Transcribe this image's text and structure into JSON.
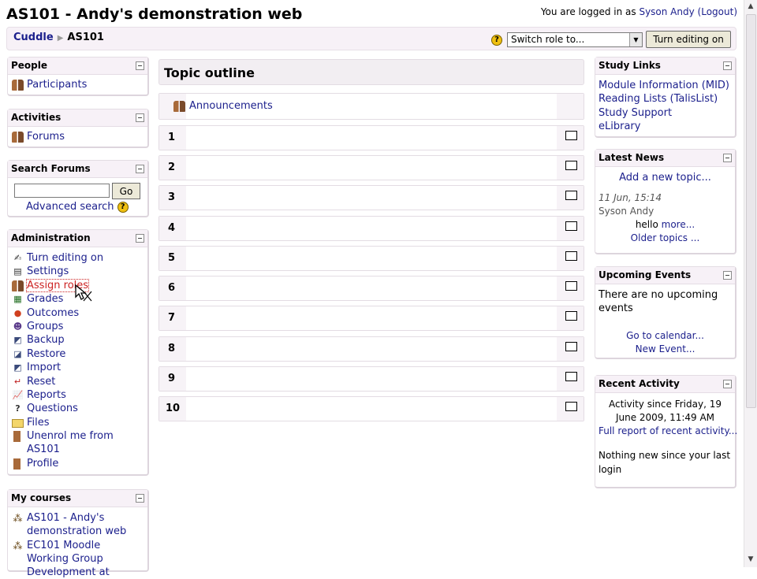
{
  "header": {
    "title": "AS101 - Andy's demonstration web",
    "login_prefix": "You are logged in as",
    "user_name": "Syson Andy",
    "logout_label": "(Logout)"
  },
  "navbar": {
    "crumbs": [
      "Cuddle",
      "AS101"
    ],
    "help_icon": "?",
    "role_select_value": "Switch role to...",
    "editing_button": "Turn editing on"
  },
  "left": {
    "people": {
      "title": "People",
      "items": [
        {
          "label": "Participants",
          "icon": "people-icon"
        }
      ]
    },
    "activities": {
      "title": "Activities",
      "items": [
        {
          "label": "Forums",
          "icon": "forum-icon"
        }
      ]
    },
    "search_forums": {
      "title": "Search Forums",
      "input_value": "",
      "go_label": "Go",
      "advanced_label": "Advanced search"
    },
    "administration": {
      "title": "Administration",
      "items": [
        {
          "label": "Turn editing on",
          "icon": "edit-icon"
        },
        {
          "label": "Settings",
          "icon": "settings-icon"
        },
        {
          "label": "Assign roles",
          "icon": "roles-icon"
        },
        {
          "label": "Grades",
          "icon": "grades-icon"
        },
        {
          "label": "Outcomes",
          "icon": "outcomes-icon"
        },
        {
          "label": "Groups",
          "icon": "groups-icon"
        },
        {
          "label": "Backup",
          "icon": "backup-icon"
        },
        {
          "label": "Restore",
          "icon": "restore-icon"
        },
        {
          "label": "Import",
          "icon": "import-icon"
        },
        {
          "label": "Reset",
          "icon": "reset-icon"
        },
        {
          "label": "Reports",
          "icon": "reports-icon"
        },
        {
          "label": "Questions",
          "icon": "questions-icon"
        },
        {
          "label": "Files",
          "icon": "folder-icon"
        },
        {
          "label": "Unenrol me from AS101",
          "icon": "unenrol-icon"
        },
        {
          "label": "Profile",
          "icon": "profile-icon"
        }
      ]
    },
    "my_courses": {
      "title": "My courses",
      "items": [
        {
          "label": "AS101 - Andy's demonstration web",
          "icon": "course-icon"
        },
        {
          "label": "EC101 Moodle Working Group Development at",
          "icon": "course-icon"
        }
      ]
    }
  },
  "center": {
    "heading": "Topic outline",
    "announcements": "Announcements",
    "topics": [
      "1",
      "2",
      "3",
      "4",
      "5",
      "6",
      "7",
      "8",
      "9",
      "10"
    ]
  },
  "right": {
    "study_links": {
      "title": "Study Links",
      "links": [
        "Module Information (MID)",
        "Reading Lists (TalisList)",
        "Study Support",
        "eLibrary"
      ]
    },
    "latest_news": {
      "title": "Latest News",
      "add_topic": "Add a new topic...",
      "date": "11 Jun, 15:14",
      "author": "Syson Andy",
      "post_text": "hello",
      "more": "more...",
      "older": "Older topics ..."
    },
    "upcoming_events": {
      "title": "Upcoming Events",
      "text": "There are no upcoming events",
      "calendar": "Go to calendar...",
      "new_event": "New Event..."
    },
    "recent_activity": {
      "title": "Recent Activity",
      "since": "Activity since Friday, 19 June 2009, 11:49 AM",
      "full_report": "Full report of recent activity...",
      "nothing": "Nothing new since your last login"
    }
  }
}
